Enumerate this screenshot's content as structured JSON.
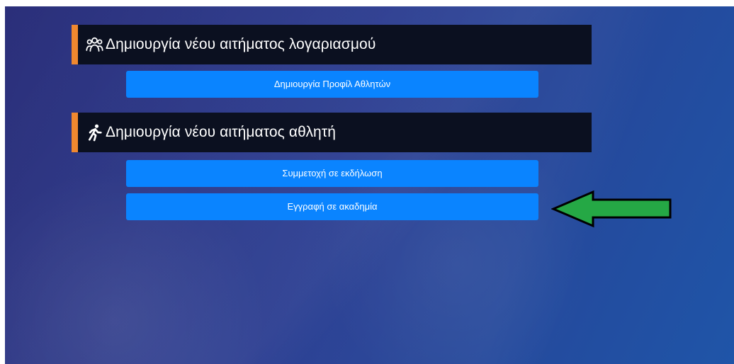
{
  "account_section": {
    "title": "Δημιουργία νέου αιτήματος λογαριασμού",
    "icon": "users-icon",
    "buttons": [
      {
        "label": "Δημιουργία Προφίλ Αθλητών"
      }
    ]
  },
  "athlete_section": {
    "title": "Δημιουργία νέου αιτήματος αθλητή",
    "icon": "running-person-icon",
    "buttons": [
      {
        "label": "Συμμετοχή σε εκδήλωση"
      },
      {
        "label": "Εγγραφή σε ακαδημία"
      }
    ]
  },
  "annotation": {
    "icon": "green-arrow-icon",
    "target": "Εγγραφή σε ακαδημία"
  },
  "colors": {
    "background_start": "#2b2f7a",
    "background_end": "#1f55a8",
    "header_background": "#0b1020",
    "header_accent": "#f0882f",
    "button": "#0a84ff",
    "arrow": "#25a845",
    "text": "#ffffff"
  }
}
